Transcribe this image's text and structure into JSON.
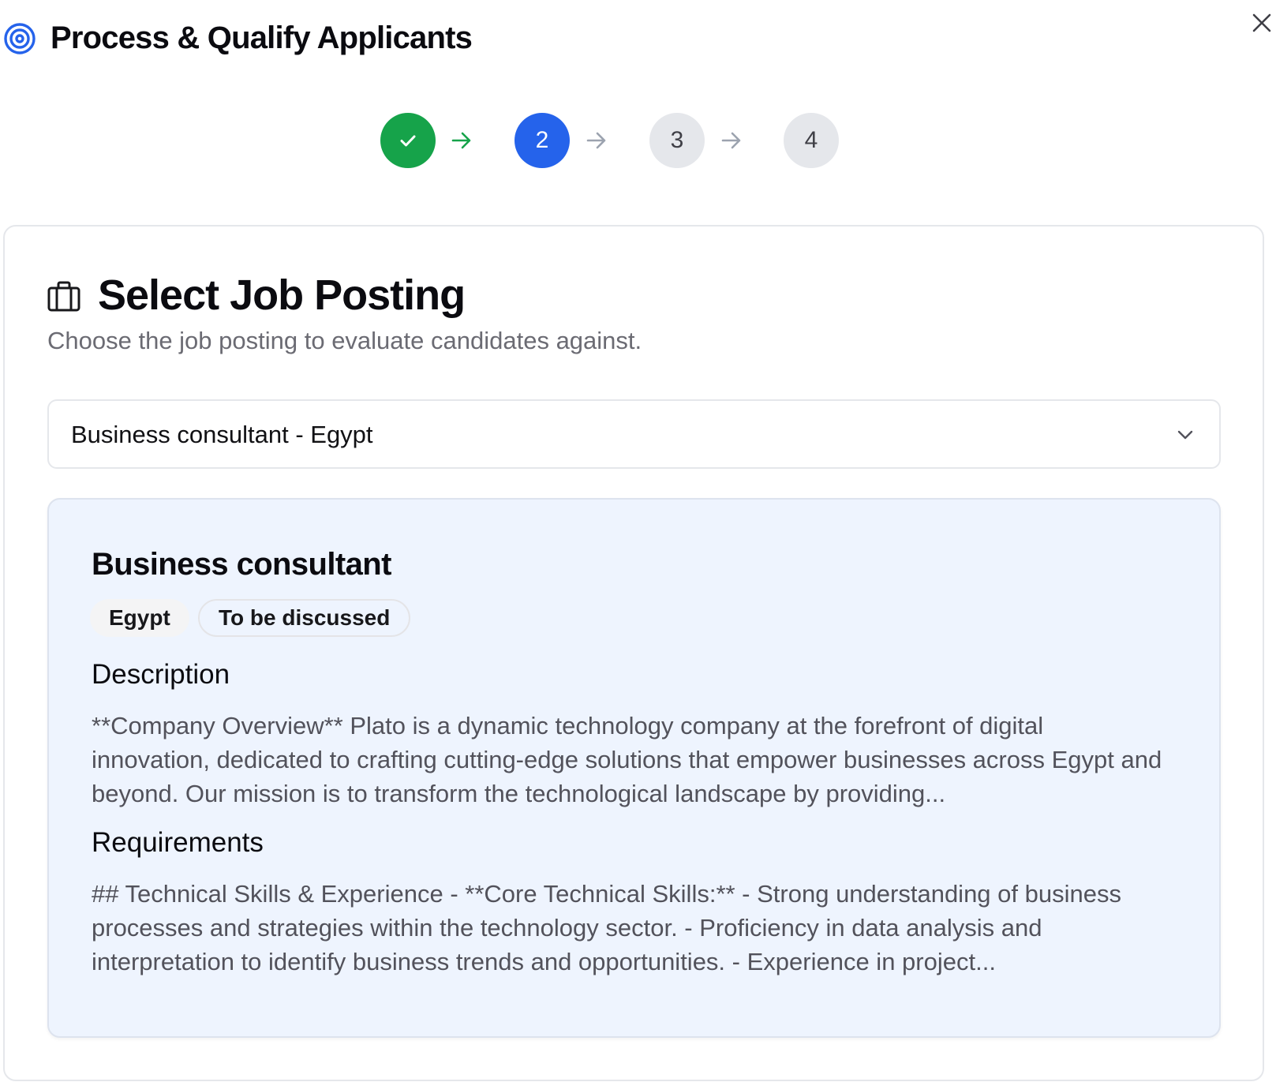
{
  "header": {
    "title": "Process & Qualify Applicants",
    "icon": "target-icon",
    "close_icon": "close-icon"
  },
  "stepper": {
    "steps": [
      {
        "label": "",
        "state": "completed",
        "icon": "check-icon"
      },
      {
        "label": "2",
        "state": "active"
      },
      {
        "label": "3",
        "state": "upcoming"
      },
      {
        "label": "4",
        "state": "upcoming"
      }
    ],
    "current_step": 2
  },
  "card": {
    "icon": "briefcase-icon",
    "title": "Select Job Posting",
    "subtitle": "Choose the job posting to evaluate candidates against.",
    "select": {
      "value": "Business consultant - Egypt",
      "icon": "chevron-down-icon"
    }
  },
  "job": {
    "title": "Business consultant",
    "badges": [
      "Egypt",
      "To be discussed"
    ],
    "description_heading": "Description",
    "description": "**Company Overview** Plato is a dynamic technology company at the forefront of digital innovation, dedicated to crafting cutting-edge solutions that empower businesses across Egypt and beyond. Our mission is to transform the technological landscape by providing...",
    "requirements_heading": "Requirements",
    "requirements": "## Technical Skills & Experience - **Core Technical Skills:** - Strong understanding of business processes and strategies within the technology sector. - Proficiency in data analysis and interpretation to identify business trends and opportunities. - Experience in project..."
  },
  "colors": {
    "primary": "#2563eb",
    "success": "#16a34a",
    "step_inactive": "#e5e7eb",
    "detail_background": "#eef4fe"
  }
}
